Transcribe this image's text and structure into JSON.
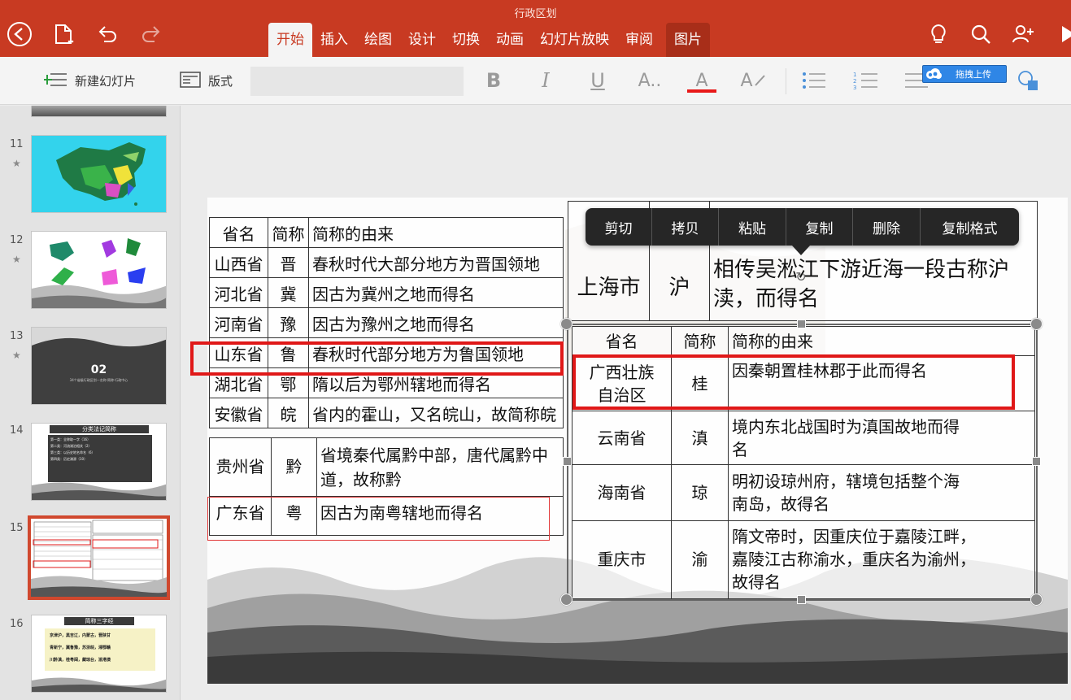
{
  "app": {
    "doc_title": "行政区划",
    "tabs": [
      {
        "label": "开始"
      },
      {
        "label": "插入"
      },
      {
        "label": "绘图"
      },
      {
        "label": "设计"
      },
      {
        "label": "切换"
      },
      {
        "label": "动画"
      },
      {
        "label": "幻灯片放映"
      },
      {
        "label": "审阅"
      },
      {
        "label": "图片"
      }
    ],
    "active_tab": "开始",
    "accent_color": "#c83a22"
  },
  "toolbar": {
    "new_slide_label": "新建幻灯片",
    "layout_label": "版式",
    "bold": "B",
    "italic": "I",
    "underline": "U",
    "font_size": "A..",
    "font_color": "A",
    "font_color_value": "#e81818",
    "upload_label": "拖拽上传"
  },
  "thumbnails": [
    {
      "number": "11"
    },
    {
      "number": "12"
    },
    {
      "number": "13",
      "title": "02",
      "subtitle": "34个省级行政区划—名称·简称·行政中心"
    },
    {
      "number": "14",
      "title": "分类法记简称",
      "lines": [
        "第一类：全称取一字（16）",
        "第二类：河流湖泊相关（2）",
        "第三类：以历史地名命名（6）",
        "第四类：历史渊源（10）"
      ]
    },
    {
      "number": "15"
    },
    {
      "number": "16",
      "title": "简称三字经",
      "lines": [
        "京津沪，黑吉辽，内蒙古，晋陕甘",
        "青新宁，冀鲁豫，苏浙皖，湘鄂赣",
        "川黔滇，桂粤闽，藏琼台，渝港澳"
      ]
    }
  ],
  "context_menu": [
    "剪切",
    "拷贝",
    "粘贴",
    "复制",
    "删除",
    "复制格式"
  ],
  "table_left": {
    "header": [
      "省名",
      "简称",
      "简称的由来"
    ],
    "rows": [
      [
        "山西省",
        "晋",
        "春秋时代大部分地方为晋国领地"
      ],
      [
        "河北省",
        "冀",
        "因古为冀州之地而得名"
      ],
      [
        "河南省",
        "豫",
        "因古为豫州之地而得名"
      ],
      [
        "山东省",
        "鲁",
        "春秋时代部分地方为鲁国领地"
      ],
      [
        "湖北省",
        "鄂",
        "隋以后为鄂州辖地而得名"
      ],
      [
        "安徽省",
        "皖",
        "省内的霍山，又名皖山，故简称皖"
      ]
    ]
  },
  "table_guizhou": {
    "rows": [
      [
        "贵州省",
        "黔",
        "省境秦代属黔中部，唐代属黔中",
        "道，故称黔"
      ],
      [
        "广东省",
        "粤",
        "因古为南粤辖地而得名",
        ""
      ]
    ]
  },
  "table_shanghai": {
    "name": "上海市",
    "abbr": "沪",
    "origin1": "相传吴淞江下游近海一段古称沪",
    "origin2": "渎，而得名"
  },
  "table_right": {
    "header": [
      "省名",
      "简称",
      "简称的由来"
    ],
    "rows": [
      {
        "name1": "广西壮族",
        "name2": "自治区",
        "abbr": "桂",
        "o1": "因秦朝置桂林郡于此而得名",
        "o2": "",
        "o3": ""
      },
      {
        "name1": "云南省",
        "name2": "",
        "abbr": "滇",
        "o1": "境内东北战国时为滇国故地而得",
        "o2": "名",
        "o3": ""
      },
      {
        "name1": "海南省",
        "name2": "",
        "abbr": "琼",
        "o1": "明初设琼州府，辖境包括整个海",
        "o2": "南岛，故得名",
        "o3": ""
      },
      {
        "name1": "重庆市",
        "name2": "",
        "abbr": "渝",
        "o1": "隋文帝时，因重庆位于嘉陵江畔，",
        "o2": "嘉陵江古称渝水，重庆名为渝州，",
        "o3": "故得名"
      }
    ]
  }
}
